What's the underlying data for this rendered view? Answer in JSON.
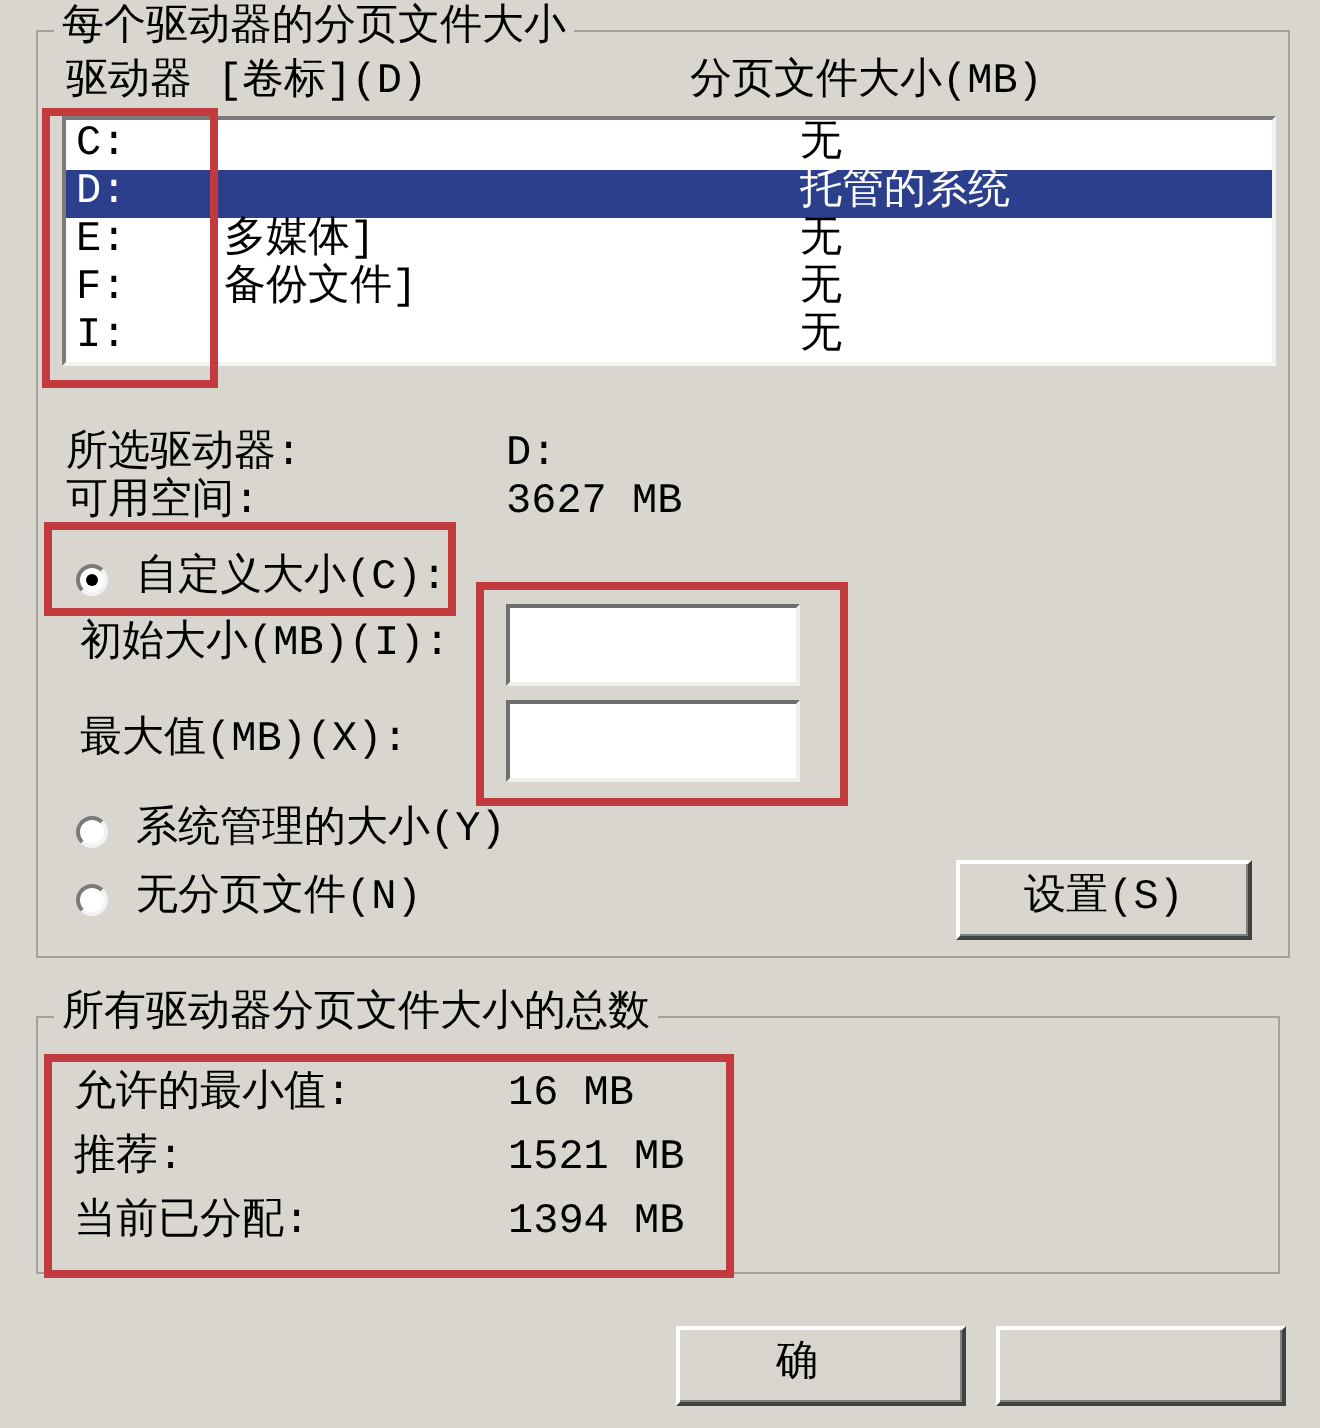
{
  "page_file_group": {
    "title": "每个驱动器的分页文件大小",
    "columns": [
      "驱动器 [卷标](D)",
      "分页文件大小(MB)"
    ],
    "drive_column_highlighted": true,
    "drives": [
      {
        "drive": "C:",
        "size": "无",
        "selected": false
      },
      {
        "drive": "D:",
        "size": "托管的系统",
        "selected": true
      },
      {
        "drive": "E:",
        "volume": "多媒体]",
        "size": "无",
        "selected": false
      },
      {
        "drive": "F:",
        "volume": "备份文件]",
        "size": "无",
        "selected": false
      },
      {
        "drive": "I:",
        "size": "无",
        "selected": false
      }
    ],
    "info": [
      {
        "label": "所选驱动器:",
        "value": "D:"
      },
      {
        "label": "可用空间:",
        "value": "3627 MB"
      }
    ],
    "options": [
      {
        "label": "自定义大小(C):",
        "selected": true,
        "highlighted": true
      },
      {
        "label": "系统管理的大小(Y)",
        "selected": false,
        "highlighted": false
      },
      {
        "label": "无分页文件(N)",
        "selected": false,
        "highlighted": false
      }
    ],
    "size_fields": {
      "highlighted": true,
      "items": [
        {
          "label": "初始大小(MB)(I):"
        },
        {
          "label": "最大值(MB)(X):"
        }
      ]
    },
    "set_button": {
      "label": "设置(S)"
    }
  },
  "totals_group": {
    "title": "所有驱动器分页文件大小的总数",
    "highlighted": true,
    "rows": [
      {
        "label": "允许的最小值:",
        "value": "16 MB"
      },
      {
        "label": "推荐:",
        "value": "1521 MB"
      },
      {
        "label": "当前已分配:",
        "value": "1394 MB"
      }
    ]
  },
  "ok_button": {
    "label": "确"
  }
}
